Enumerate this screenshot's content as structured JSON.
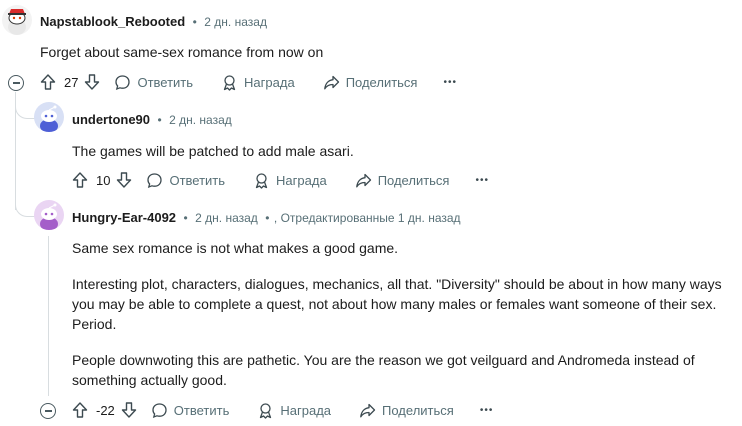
{
  "comments": [
    {
      "author": "Napstablook_Rebooted",
      "time": "2 дн. назад",
      "body": [
        "Forget about same-sex romance from now on"
      ],
      "score": "27"
    },
    {
      "author": "undertone90",
      "time": "2 дн. назад",
      "body": [
        "The games will be patched to add male asari."
      ],
      "score": "10"
    },
    {
      "author": "Hungry-Ear-4092",
      "time": "2 дн. назад",
      "edited": ", Отредактированные 1 дн. назад",
      "body": [
        "Same sex romance is not what makes a good game.",
        "Interesting plot, characters, dialogues, mechanics, all that. \"Diversity\" should be about in how many ways you may be able to complete a quest, not about how many males or females want someone of their sex. Period.",
        "People downwoting this are pathetic. You are the reason we got veilguard and Andromeda instead of something actually good."
      ],
      "score": "-22"
    }
  ],
  "actions": {
    "reply": "Ответить",
    "award": "Награда",
    "share": "Поделиться",
    "more": "•••"
  },
  "separator": "•"
}
